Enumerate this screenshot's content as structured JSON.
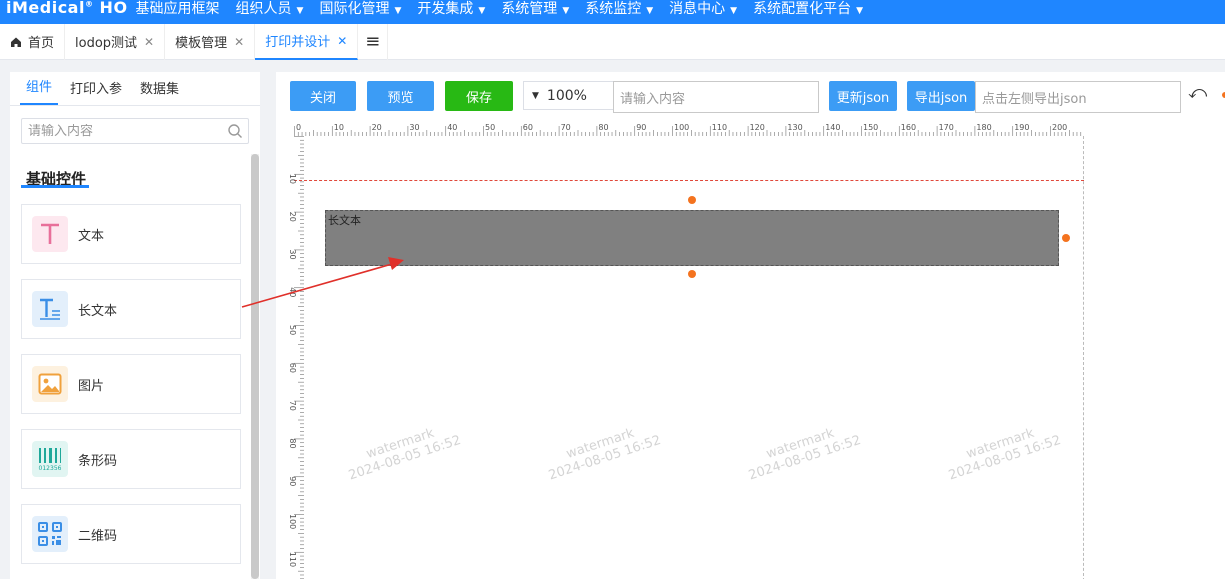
{
  "app": {
    "logo": "iMedical",
    "logo_sup": "®",
    "logo_suffix": "HO"
  },
  "topnav": {
    "items": [
      {
        "label": "基础应用框架",
        "caret": false
      },
      {
        "label": "组织人员",
        "caret": true
      },
      {
        "label": "国际化管理",
        "caret": true
      },
      {
        "label": "开发集成",
        "caret": true
      },
      {
        "label": "系统管理",
        "caret": true
      },
      {
        "label": "系统监控",
        "caret": true
      },
      {
        "label": "消息中心",
        "caret": true
      },
      {
        "label": "系统配置化平台",
        "caret": true
      }
    ]
  },
  "tabs": [
    {
      "label": "首页",
      "icon": "home-icon",
      "closable": false,
      "active": false
    },
    {
      "label": "lodop测试",
      "closable": true,
      "active": false
    },
    {
      "label": "模板管理",
      "closable": true,
      "active": false
    },
    {
      "label": "打印并设计",
      "closable": true,
      "active": true
    }
  ],
  "left": {
    "tabs": [
      "组件",
      "打印入参",
      "数据集"
    ],
    "active_tab": "组件",
    "search_placeholder": "请输入内容",
    "section_title": "基础控件",
    "components": [
      {
        "label": "文本",
        "icon": "text-icon",
        "color": "#e8709a",
        "bg": "#fde8ef"
      },
      {
        "label": "长文本",
        "icon": "long-text-icon",
        "color": "#3a8ee6",
        "bg": "#e3effb"
      },
      {
        "label": "图片",
        "icon": "image-icon",
        "color": "#f0a13c",
        "bg": "#fdf1df"
      },
      {
        "label": "条形码",
        "icon": "barcode-icon",
        "color": "#1fa89a",
        "bg": "#e1f5f2",
        "sub": "012356"
      },
      {
        "label": "二维码",
        "icon": "qrcode-icon",
        "color": "#3a8ee6",
        "bg": "#e3effb"
      }
    ]
  },
  "toolbar": {
    "close": "关闭",
    "preview": "预览",
    "save": "保存",
    "zoom": "100%",
    "input_placeholder": "请输入内容",
    "update_json": "更新json",
    "export_json": "导出json",
    "export_placeholder": "点击左侧导出json"
  },
  "designer": {
    "ruler_top_labels": [
      "0",
      "10",
      "20",
      "30",
      "40",
      "50",
      "60",
      "70",
      "80",
      "90",
      "100",
      "110",
      "120",
      "130",
      "140",
      "150",
      "160",
      "170",
      "180",
      "190",
      "200"
    ],
    "ruler_left_labels": [
      "10",
      "20",
      "30",
      "40",
      "50",
      "60",
      "70",
      "80",
      "90",
      "100",
      "110"
    ],
    "element_text": "长文本",
    "watermark_line1": "watermark",
    "watermark_line2": "2024-08-05 16:52"
  },
  "colors": {
    "primary": "#1f86ff",
    "button_blue": "#3c9cf5",
    "button_green": "#28b914",
    "handle": "#f4731f",
    "arrow": "#e0302a"
  }
}
